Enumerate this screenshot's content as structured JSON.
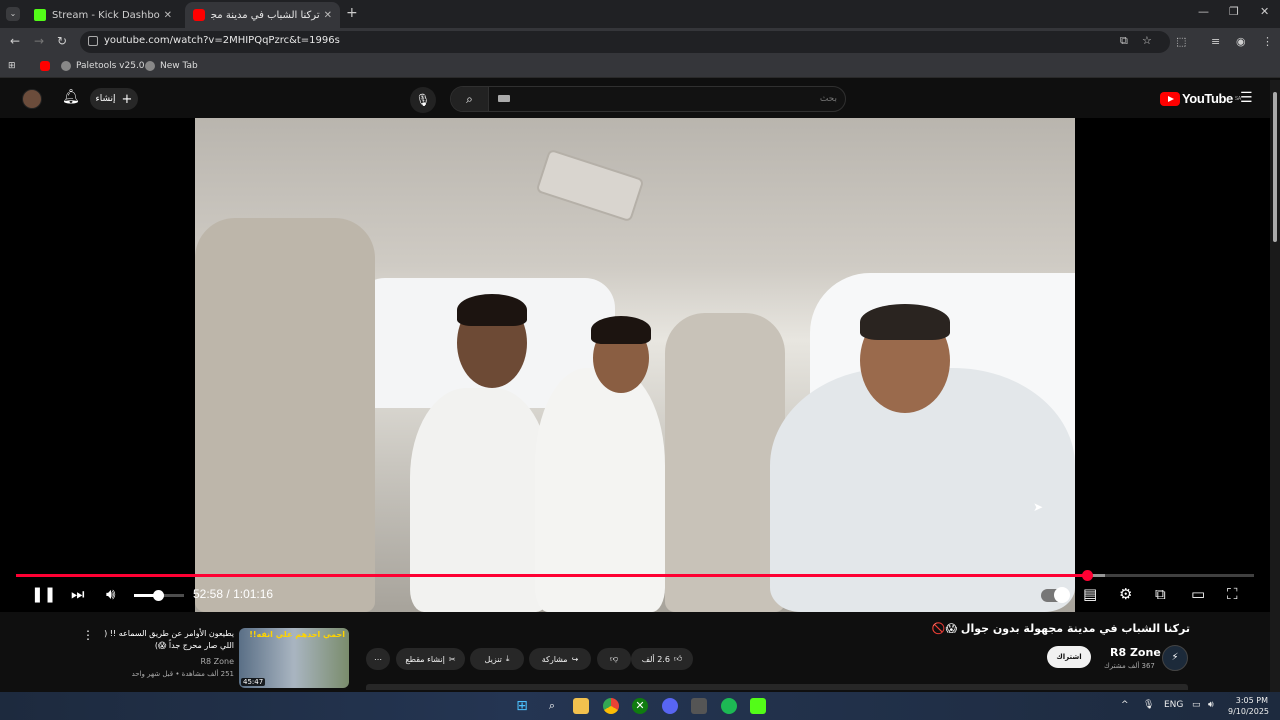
{
  "browser": {
    "tabs": [
      {
        "label": "Stream - Kick Dashboard",
        "favicon_color": "#53fc18",
        "close": "✕"
      },
      {
        "label": "تركنا الشباب في مدينة مجهولة",
        "favicon_color": "#ff0000",
        "close": "✕"
      }
    ],
    "new_tab": "+",
    "url": "youtube.com/watch?v=2MHIPQqPzrc&t=1996s",
    "bookmarks": [
      "Paletools v25.0.0",
      "New Tab"
    ]
  },
  "youtube": {
    "create_label": "إنشاء",
    "search_placeholder": "بحث",
    "logo_text": "YouTube",
    "region": "SA"
  },
  "player": {
    "current_time": "52:58",
    "separator": "/",
    "duration": "1:01:16",
    "progress_fraction": 0.865,
    "buffered_fraction": 0.88,
    "volume_fraction": 0.48
  },
  "video": {
    "title": "تركنا الشباب في مدينة مجهولة بدون جوال 😱🚫",
    "channel": "R8 Zone",
    "subscribers": "367 ألف مشترك",
    "subscribe_label": "اشتراك",
    "likes": "2.6 ألف",
    "share_label": "مشاركة",
    "download_label": "تنزيل",
    "clip_label": "إنشاء مقطع",
    "more_label": "⋯"
  },
  "recommended": {
    "title": "يطيعون الأوامر عن طريق السماعه !! ( اللي صار محرج جداً 😱)",
    "channel": "R8 Zone",
    "meta": "251 ألف مشاهدة • قبل شهر واحد",
    "duration": "45:47",
    "thumb_text": "احمي احدهم علي انفه!!"
  },
  "taskbar": {
    "lang": "ENG",
    "time": "3:05 PM",
    "date": "9/10/2025"
  }
}
